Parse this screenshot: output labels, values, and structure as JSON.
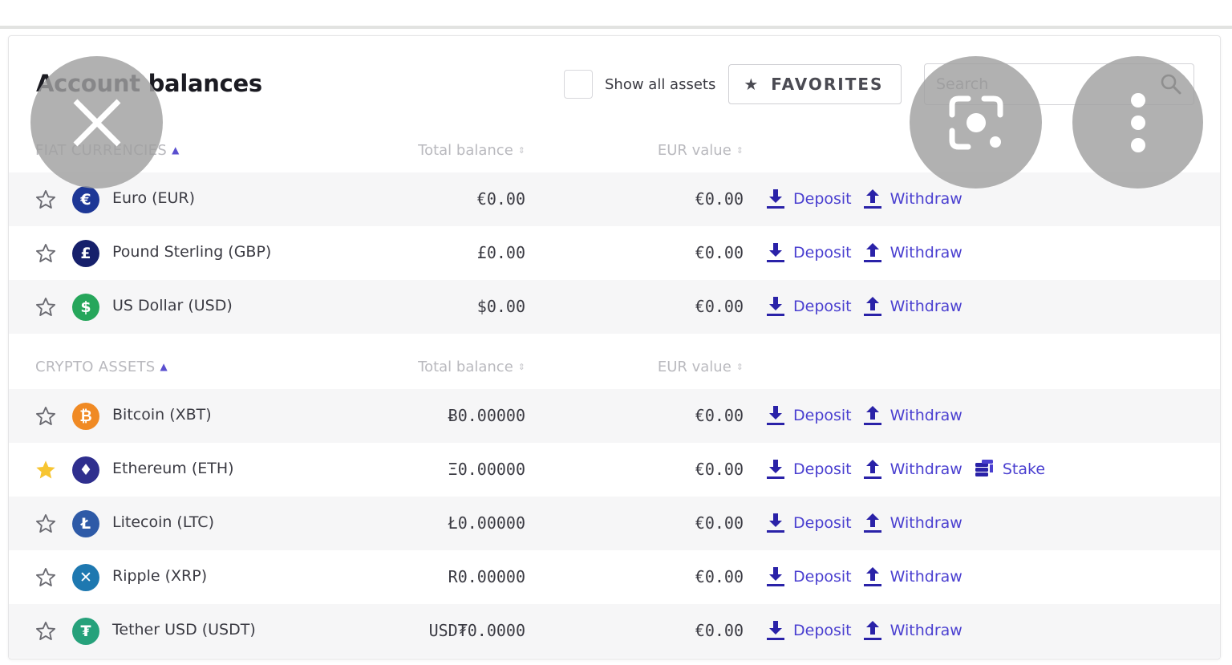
{
  "page": {
    "title": "Account balances"
  },
  "toolbar": {
    "show_all_assets_label": "Show all assets",
    "show_all_assets_checked": false,
    "favorites_label": "FAVORITES",
    "search_placeholder": "Search",
    "search_value": ""
  },
  "colors": {
    "accent": "#4a3fd0",
    "favorite_star": "#f7c531",
    "alt_row": "#f6f6f7"
  },
  "fiat": {
    "header": {
      "asset": "FIAT CURRENCIES",
      "total": "Total balance",
      "eur": "EUR value"
    },
    "rows": [
      {
        "name": "Euro (EUR)",
        "total": "€0.00",
        "eur": "€0.00",
        "favorite": false,
        "icon": "euro-icon",
        "glyph": "€",
        "color": "#1d3796",
        "actions": [
          "Deposit",
          "Withdraw"
        ]
      },
      {
        "name": "Pound Sterling (GBP)",
        "total": "£0.00",
        "eur": "€0.00",
        "favorite": false,
        "icon": "pound-icon",
        "glyph": "£",
        "color": "#16206b",
        "actions": [
          "Deposit",
          "Withdraw"
        ]
      },
      {
        "name": "US Dollar (USD)",
        "total": "$0.00",
        "eur": "€0.00",
        "favorite": false,
        "icon": "dollar-icon",
        "glyph": "$",
        "color": "#26a65b",
        "actions": [
          "Deposit",
          "Withdraw"
        ]
      }
    ]
  },
  "crypto": {
    "header": {
      "asset": "CRYPTO ASSETS",
      "total": "Total balance",
      "eur": "EUR value"
    },
    "rows": [
      {
        "name": "Bitcoin (XBT)",
        "total": "Ƀ0.00000",
        "eur": "€0.00",
        "favorite": false,
        "icon": "bitcoin-icon",
        "glyph": "₿",
        "color": "#f08a24",
        "actions": [
          "Deposit",
          "Withdraw"
        ]
      },
      {
        "name": "Ethereum (ETH)",
        "total": "Ξ0.00000",
        "eur": "€0.00",
        "favorite": true,
        "icon": "ethereum-icon",
        "glyph": "♦",
        "color": "#2f2f8e",
        "actions": [
          "Deposit",
          "Withdraw",
          "Stake"
        ]
      },
      {
        "name": "Litecoin (LTC)",
        "total": "Ł0.00000",
        "eur": "€0.00",
        "favorite": false,
        "icon": "litecoin-icon",
        "glyph": "Ł",
        "color": "#2e5aa7",
        "actions": [
          "Deposit",
          "Withdraw"
        ]
      },
      {
        "name": "Ripple (XRP)",
        "total": "R0.00000",
        "eur": "€0.00",
        "favorite": false,
        "icon": "ripple-icon",
        "glyph": "✕",
        "color": "#1e78b0",
        "actions": [
          "Deposit",
          "Withdraw"
        ]
      },
      {
        "name": "Tether USD (USDT)",
        "total": "USD₮0.0000",
        "eur": "€0.00",
        "favorite": false,
        "icon": "tether-icon",
        "glyph": "₮",
        "color": "#26a17b",
        "actions": [
          "Deposit",
          "Withdraw"
        ]
      }
    ]
  },
  "overlay": {
    "close": "close-icon",
    "lens": "lens-icon",
    "more": "more-vertical-icon"
  }
}
